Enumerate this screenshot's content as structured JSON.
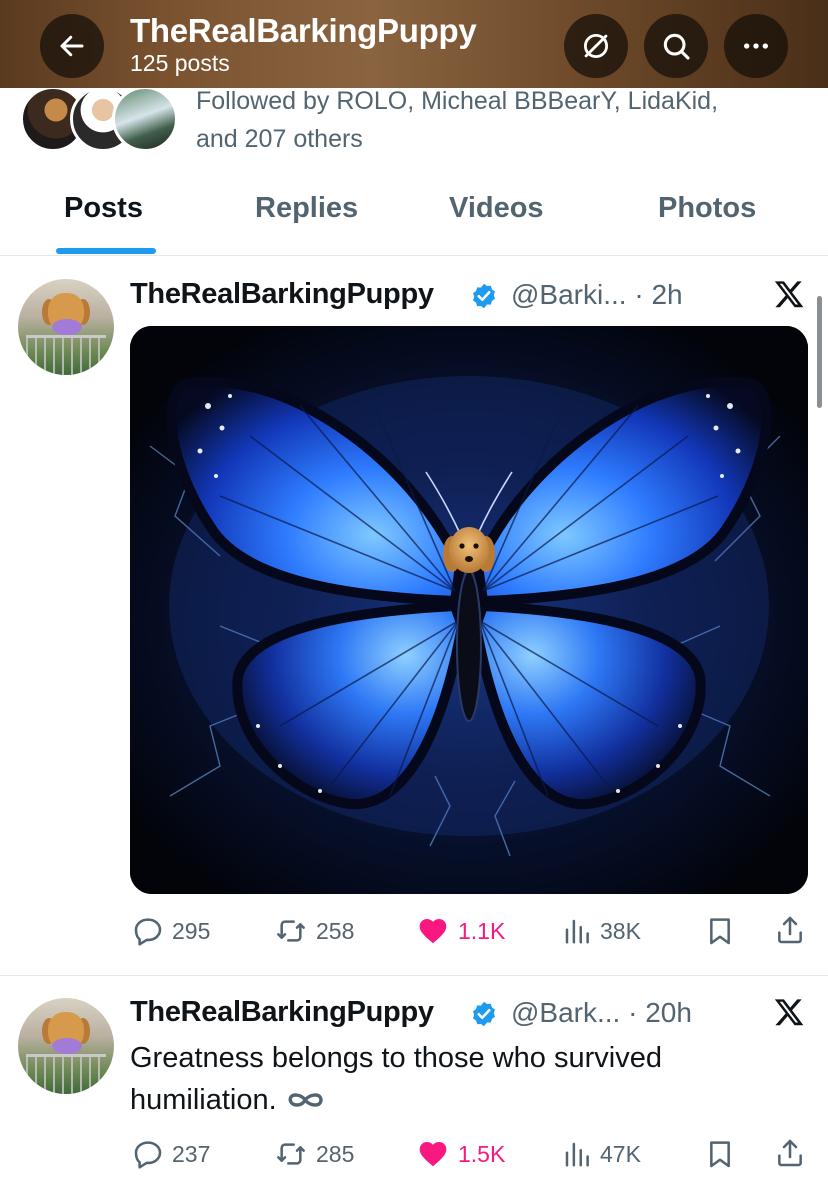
{
  "header": {
    "title": "TheRealBarkingPuppy",
    "post_count": "125 posts",
    "icons": [
      "back-arrow-icon",
      "grok-icon",
      "search-icon",
      "more-icon"
    ]
  },
  "profile": {
    "followed_by_line1": "Followed by ROLO, Micheal BBBearY, LidaKid,",
    "followed_by_line2": "and 207 others"
  },
  "tabs": [
    {
      "label": "Posts",
      "active": true
    },
    {
      "label": "Replies",
      "active": false
    },
    {
      "label": "Videos",
      "active": false
    },
    {
      "label": "Photos",
      "active": false
    }
  ],
  "posts": [
    {
      "name": "TheRealBarkingPuppy",
      "handle_time": "@Barki... · 2h",
      "has_image": true,
      "replies": "295",
      "reposts": "258",
      "likes": "1.1K",
      "views": "38K"
    },
    {
      "name": "TheRealBarkingPuppy",
      "handle_time": "@Bark... · 20h",
      "text_line1": "Greatness belongs to those who survived",
      "text_line2": "humiliation.",
      "replies": "237",
      "reposts": "285",
      "likes": "1.5K",
      "views": "47K"
    }
  ],
  "colors": {
    "accent": "#1d9bf0",
    "like": "#f91880",
    "secondary_text": "#536471",
    "primary_text": "#0f1419"
  }
}
